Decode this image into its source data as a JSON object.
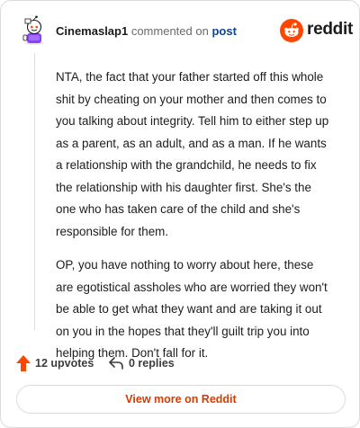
{
  "header": {
    "username": "Cinemaslap1",
    "action_text": "commented on",
    "post_link_text": "post",
    "brand_wordmark": "reddit"
  },
  "comment": {
    "paragraphs": [
      "NTA, the fact that your father started off this whole shit by cheating on your mother and then comes to you talking about integrity. Tell him to either step up as a parent, as an adult, and as a man. If he wants a relationship with the grandchild, he needs to fix the relationship with his daughter first. She's the one who has taken care of the child and she's responsible for them.",
      "OP, you have nothing to worry about here, these are egotistical assholes who are worried they won't be able to get what they want and are taking it out on you in the hopes that they'll guilt trip you into helping them. Don't fall for it."
    ]
  },
  "footer": {
    "upvotes_label": "12 upvotes",
    "replies_label": "0 replies"
  },
  "cta": {
    "view_more_label": "View more on Reddit"
  },
  "colors": {
    "accent": "#d93a00",
    "brand": "#ff4500",
    "link": "#0a449b",
    "border": "#dcdcdc"
  },
  "icons": {
    "avatar": "snoo-avatar-icon",
    "logo": "reddit-logo-icon",
    "upvote": "upvote-arrow-icon",
    "reply": "reply-arrow-icon"
  }
}
